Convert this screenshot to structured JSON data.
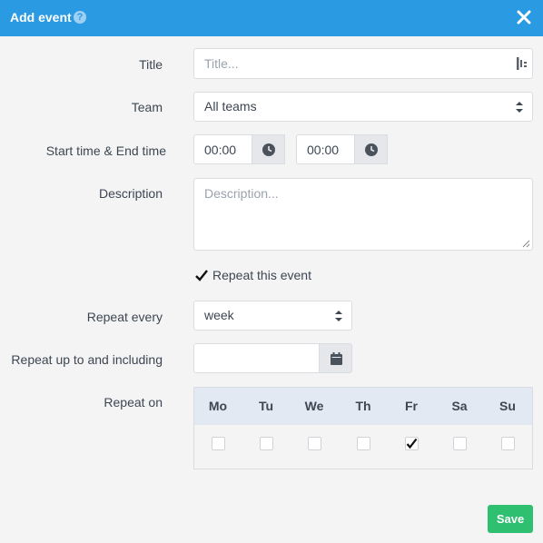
{
  "header": {
    "title": "Add event",
    "help_glyph": "?"
  },
  "form": {
    "title_label": "Title",
    "title_placeholder": "Title...",
    "team_label": "Team",
    "team_value": "All teams",
    "time_label": "Start time & End time",
    "start_time": "00:00",
    "end_time": "00:00",
    "description_label": "Description",
    "description_placeholder": "Description...",
    "repeat_checkbox_label": "Repeat this event",
    "repeat_every_label": "Repeat every",
    "repeat_every_value": "week",
    "repeat_until_label": "Repeat up to and including",
    "repeat_until_value": "",
    "repeat_on_label": "Repeat on"
  },
  "days": [
    {
      "label": "Mo",
      "checked": false
    },
    {
      "label": "Tu",
      "checked": false
    },
    {
      "label": "We",
      "checked": false
    },
    {
      "label": "Th",
      "checked": false
    },
    {
      "label": "Fr",
      "checked": true
    },
    {
      "label": "Sa",
      "checked": false
    },
    {
      "label": "Su",
      "checked": false
    }
  ],
  "footer": {
    "save_label": "Save"
  },
  "colors": {
    "header": "#2a9ae3",
    "save": "#2fbf71",
    "days_header": "#e3e9f3"
  }
}
